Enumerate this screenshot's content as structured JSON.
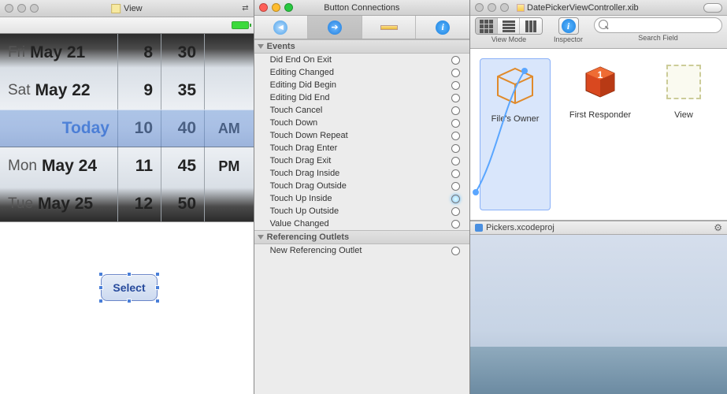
{
  "left": {
    "title": "View",
    "picker": {
      "dates": [
        {
          "weekday": "Fri",
          "date": "May 21"
        },
        {
          "weekday": "Sat",
          "date": "May 22"
        },
        {
          "weekday": "",
          "date": "Today",
          "today": true
        },
        {
          "weekday": "Mon",
          "date": "May 24"
        },
        {
          "weekday": "Tue",
          "date": "May 25"
        }
      ],
      "hours": [
        "8",
        "9",
        "10",
        "11",
        "12"
      ],
      "minutes": [
        "30",
        "35",
        "40",
        "45",
        "50"
      ],
      "ampm": [
        "AM",
        "PM"
      ]
    },
    "select_button": "Select"
  },
  "middle": {
    "title": "Button Connections",
    "sections": {
      "events": {
        "header": "Events",
        "items": [
          "Did End On Exit",
          "Editing Changed",
          "Editing Did Begin",
          "Editing Did End",
          "Touch Cancel",
          "Touch Down",
          "Touch Down Repeat",
          "Touch Drag Enter",
          "Touch Drag Exit",
          "Touch Drag Inside",
          "Touch Drag Outside",
          "Touch Up Inside",
          "Touch Up Outside",
          "Value Changed"
        ],
        "active_index": 11
      },
      "outlets": {
        "header": "Referencing Outlets",
        "items": [
          "New Referencing Outlet"
        ]
      }
    }
  },
  "right": {
    "title": "DatePickerViewController.xib",
    "toolbar": {
      "view_mode": "View Mode",
      "inspector": "Inspector",
      "search_label": "Search Field",
      "search_placeholder": ""
    },
    "objects": [
      {
        "label": "File's Owner",
        "selected": true
      },
      {
        "label": "First Responder"
      },
      {
        "label": "View"
      }
    ],
    "status": "Pickers.xcodeproj"
  }
}
